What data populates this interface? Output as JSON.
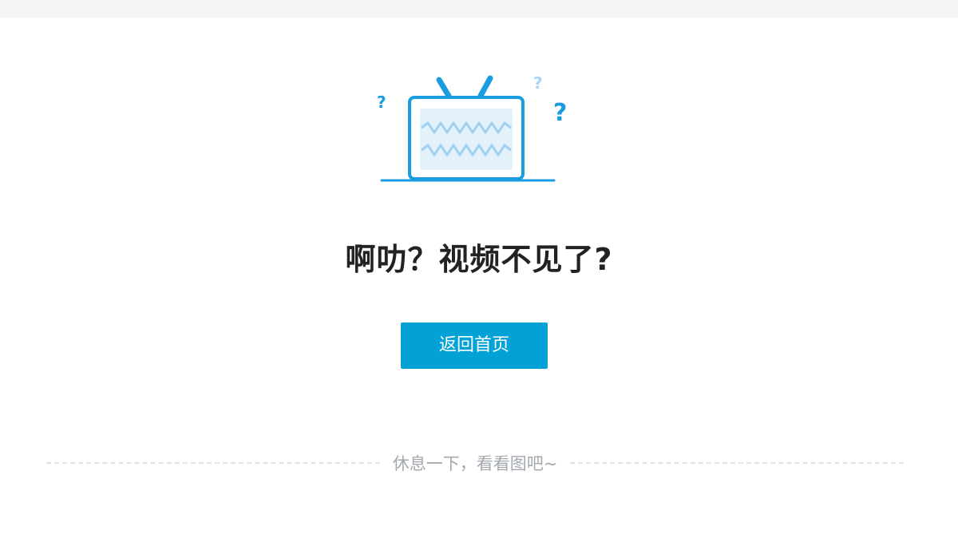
{
  "page": {
    "headline": "啊叻？视频不见了?",
    "home_button_label": "返回首页",
    "divider_text": "休息一下，看看图吧~"
  },
  "illustration": {
    "icon": "broken-tv-icon",
    "question_mark": "?",
    "colors": {
      "stroke": "#1a9ce0",
      "screen_fill": "#e3f1fb",
      "wave": "#9fd0ef",
      "question_light": "#a8d6f2"
    }
  },
  "colors": {
    "button_bg": "#03a2d6",
    "headline": "#222222",
    "divider_text": "#a2a8ae",
    "divider_line": "#dfe3e8",
    "top_strip": "#f4f5f7"
  }
}
